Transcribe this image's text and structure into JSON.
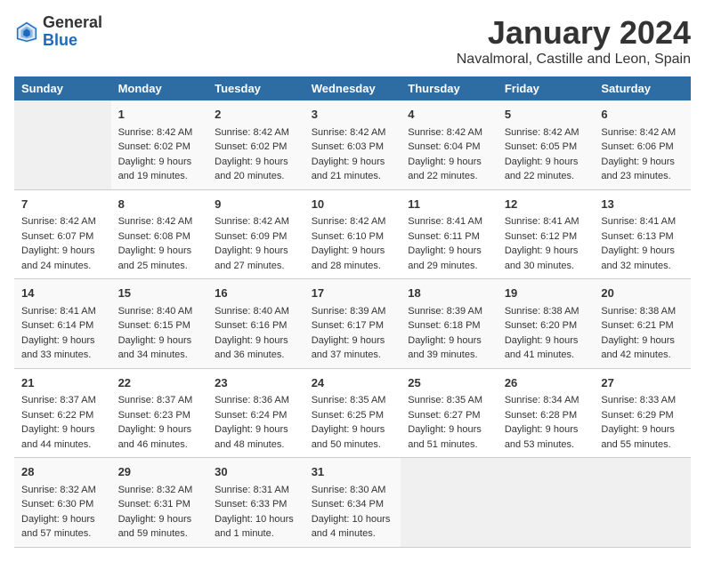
{
  "header": {
    "logo_general": "General",
    "logo_blue": "Blue",
    "title": "January 2024",
    "location": "Navalmoral, Castille and Leon, Spain"
  },
  "columns": [
    "Sunday",
    "Monday",
    "Tuesday",
    "Wednesday",
    "Thursday",
    "Friday",
    "Saturday"
  ],
  "weeks": [
    [
      {
        "day": "",
        "info": ""
      },
      {
        "day": "1",
        "info": "Sunrise: 8:42 AM\nSunset: 6:02 PM\nDaylight: 9 hours\nand 19 minutes."
      },
      {
        "day": "2",
        "info": "Sunrise: 8:42 AM\nSunset: 6:02 PM\nDaylight: 9 hours\nand 20 minutes."
      },
      {
        "day": "3",
        "info": "Sunrise: 8:42 AM\nSunset: 6:03 PM\nDaylight: 9 hours\nand 21 minutes."
      },
      {
        "day": "4",
        "info": "Sunrise: 8:42 AM\nSunset: 6:04 PM\nDaylight: 9 hours\nand 22 minutes."
      },
      {
        "day": "5",
        "info": "Sunrise: 8:42 AM\nSunset: 6:05 PM\nDaylight: 9 hours\nand 22 minutes."
      },
      {
        "day": "6",
        "info": "Sunrise: 8:42 AM\nSunset: 6:06 PM\nDaylight: 9 hours\nand 23 minutes."
      }
    ],
    [
      {
        "day": "7",
        "info": "Sunrise: 8:42 AM\nSunset: 6:07 PM\nDaylight: 9 hours\nand 24 minutes."
      },
      {
        "day": "8",
        "info": "Sunrise: 8:42 AM\nSunset: 6:08 PM\nDaylight: 9 hours\nand 25 minutes."
      },
      {
        "day": "9",
        "info": "Sunrise: 8:42 AM\nSunset: 6:09 PM\nDaylight: 9 hours\nand 27 minutes."
      },
      {
        "day": "10",
        "info": "Sunrise: 8:42 AM\nSunset: 6:10 PM\nDaylight: 9 hours\nand 28 minutes."
      },
      {
        "day": "11",
        "info": "Sunrise: 8:41 AM\nSunset: 6:11 PM\nDaylight: 9 hours\nand 29 minutes."
      },
      {
        "day": "12",
        "info": "Sunrise: 8:41 AM\nSunset: 6:12 PM\nDaylight: 9 hours\nand 30 minutes."
      },
      {
        "day": "13",
        "info": "Sunrise: 8:41 AM\nSunset: 6:13 PM\nDaylight: 9 hours\nand 32 minutes."
      }
    ],
    [
      {
        "day": "14",
        "info": "Sunrise: 8:41 AM\nSunset: 6:14 PM\nDaylight: 9 hours\nand 33 minutes."
      },
      {
        "day": "15",
        "info": "Sunrise: 8:40 AM\nSunset: 6:15 PM\nDaylight: 9 hours\nand 34 minutes."
      },
      {
        "day": "16",
        "info": "Sunrise: 8:40 AM\nSunset: 6:16 PM\nDaylight: 9 hours\nand 36 minutes."
      },
      {
        "day": "17",
        "info": "Sunrise: 8:39 AM\nSunset: 6:17 PM\nDaylight: 9 hours\nand 37 minutes."
      },
      {
        "day": "18",
        "info": "Sunrise: 8:39 AM\nSunset: 6:18 PM\nDaylight: 9 hours\nand 39 minutes."
      },
      {
        "day": "19",
        "info": "Sunrise: 8:38 AM\nSunset: 6:20 PM\nDaylight: 9 hours\nand 41 minutes."
      },
      {
        "day": "20",
        "info": "Sunrise: 8:38 AM\nSunset: 6:21 PM\nDaylight: 9 hours\nand 42 minutes."
      }
    ],
    [
      {
        "day": "21",
        "info": "Sunrise: 8:37 AM\nSunset: 6:22 PM\nDaylight: 9 hours\nand 44 minutes."
      },
      {
        "day": "22",
        "info": "Sunrise: 8:37 AM\nSunset: 6:23 PM\nDaylight: 9 hours\nand 46 minutes."
      },
      {
        "day": "23",
        "info": "Sunrise: 8:36 AM\nSunset: 6:24 PM\nDaylight: 9 hours\nand 48 minutes."
      },
      {
        "day": "24",
        "info": "Sunrise: 8:35 AM\nSunset: 6:25 PM\nDaylight: 9 hours\nand 50 minutes."
      },
      {
        "day": "25",
        "info": "Sunrise: 8:35 AM\nSunset: 6:27 PM\nDaylight: 9 hours\nand 51 minutes."
      },
      {
        "day": "26",
        "info": "Sunrise: 8:34 AM\nSunset: 6:28 PM\nDaylight: 9 hours\nand 53 minutes."
      },
      {
        "day": "27",
        "info": "Sunrise: 8:33 AM\nSunset: 6:29 PM\nDaylight: 9 hours\nand 55 minutes."
      }
    ],
    [
      {
        "day": "28",
        "info": "Sunrise: 8:32 AM\nSunset: 6:30 PM\nDaylight: 9 hours\nand 57 minutes."
      },
      {
        "day": "29",
        "info": "Sunrise: 8:32 AM\nSunset: 6:31 PM\nDaylight: 9 hours\nand 59 minutes."
      },
      {
        "day": "30",
        "info": "Sunrise: 8:31 AM\nSunset: 6:33 PM\nDaylight: 10 hours\nand 1 minute."
      },
      {
        "day": "31",
        "info": "Sunrise: 8:30 AM\nSunset: 6:34 PM\nDaylight: 10 hours\nand 4 minutes."
      },
      {
        "day": "",
        "info": ""
      },
      {
        "day": "",
        "info": ""
      },
      {
        "day": "",
        "info": ""
      }
    ]
  ]
}
